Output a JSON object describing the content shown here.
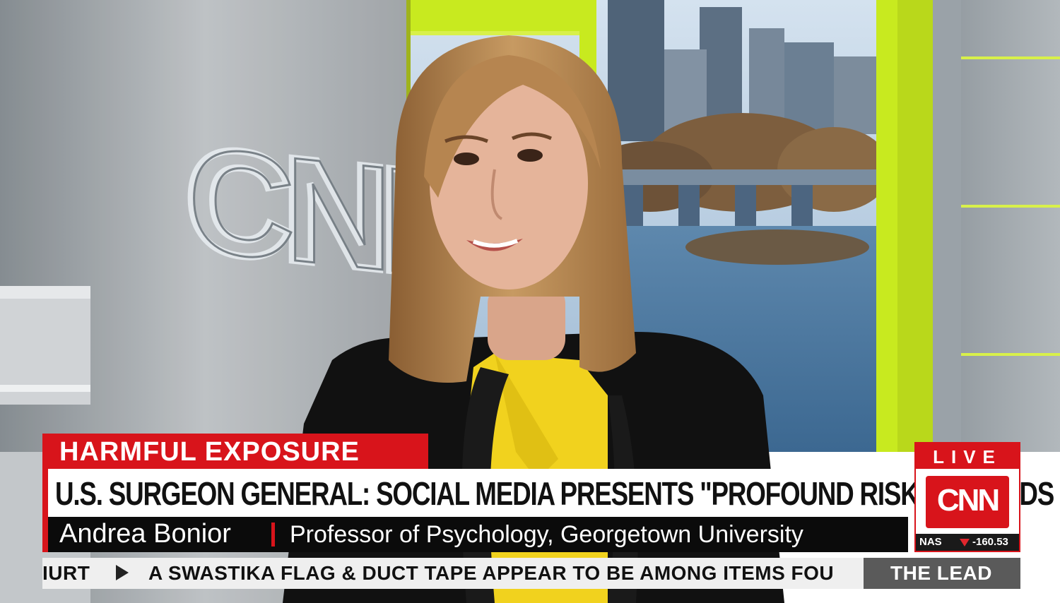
{
  "broadcast": {
    "topic": "HARMFUL EXPOSURE",
    "headline": "U.S. SURGEON GENERAL: SOCIAL MEDIA PRESENTS \"PROFOUND RISK\" FOR KIDS",
    "guest_name": "Andrea Bonior",
    "guest_title": "Professor of Psychology, Georgetown University",
    "ticker_tail": "IURT",
    "ticker_story": "A SWASTIKA FLAG & DUCT TAPE APPEAR TO BE AMONG ITEMS FOU",
    "show_name": "THE LEAD",
    "live_label": "LIVE",
    "network_logo": "CNN",
    "market_index": "NAS",
    "market_change": "-160.53",
    "wall_logo": "CNN"
  },
  "colors": {
    "cnn_red": "#d8141b",
    "accent_green": "#c8ea1f",
    "blazer": "#111111",
    "blouse": "#f1d21e",
    "hair": "#b68550"
  }
}
